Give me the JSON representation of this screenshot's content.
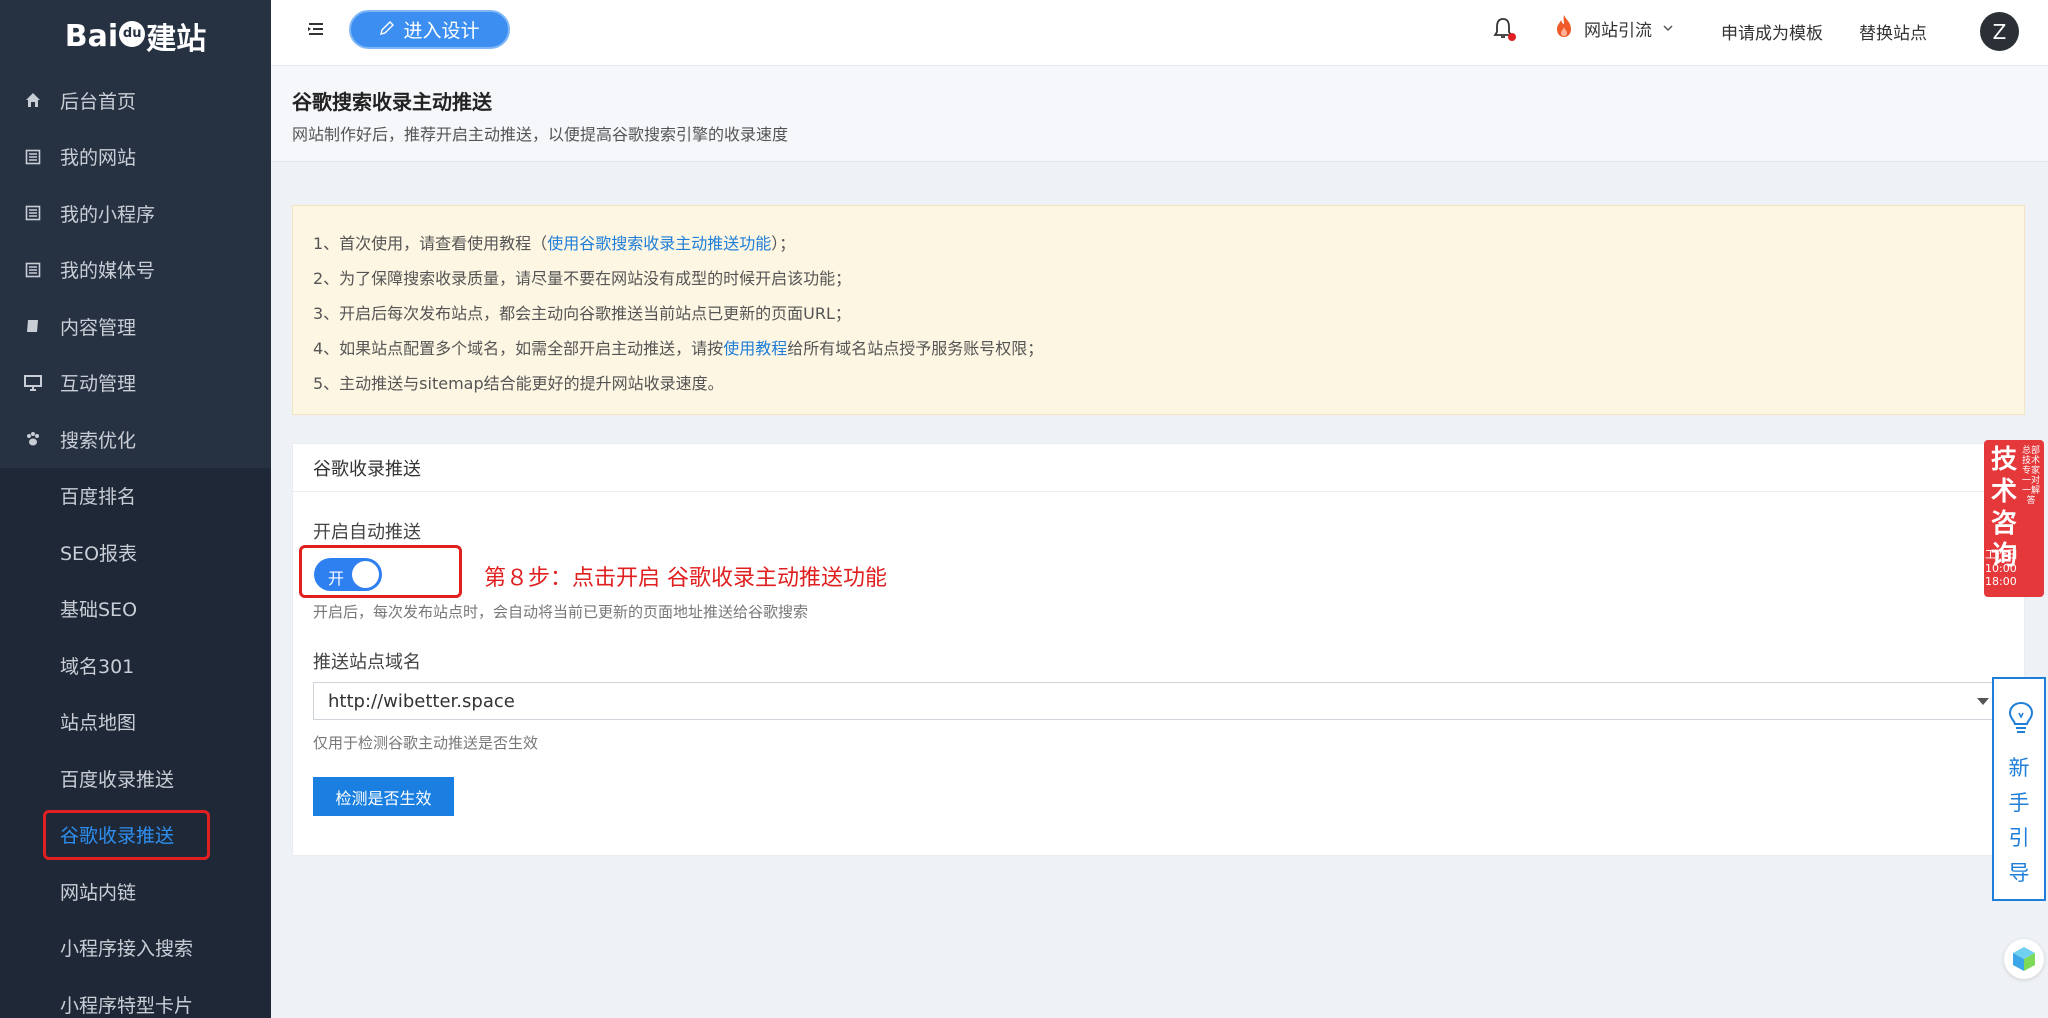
{
  "logo": {
    "text_before": "Bai",
    "paw_text": "du",
    "text_after": "建站"
  },
  "sidebar": {
    "items": [
      {
        "label": "后台首页",
        "icon": "home-icon"
      },
      {
        "label": "我的网站",
        "icon": "document-icon"
      },
      {
        "label": "我的小程序",
        "icon": "document-icon"
      },
      {
        "label": "我的媒体号",
        "icon": "document-icon"
      },
      {
        "label": "内容管理",
        "icon": "book-icon"
      },
      {
        "label": "互动管理",
        "icon": "monitor-icon"
      },
      {
        "label": "搜索优化",
        "icon": "paw-icon"
      }
    ],
    "sub_items": [
      {
        "label": "百度排名"
      },
      {
        "label": "SEO报表"
      },
      {
        "label": "基础SEO"
      },
      {
        "label": "域名301"
      },
      {
        "label": "站点地图"
      },
      {
        "label": "百度收录推送"
      },
      {
        "label": "谷歌收录推送",
        "active": true
      },
      {
        "label": "网站内链"
      },
      {
        "label": "小程序接入搜索"
      },
      {
        "label": "小程序特型卡片"
      }
    ]
  },
  "topbar": {
    "design_button": "进入设计",
    "traffic_label": "网站引流",
    "apply_template": "申请成为模板",
    "switch_site": "替换站点",
    "avatar_letter": "Z"
  },
  "page": {
    "title": "谷歌搜索收录主动推送",
    "subtitle": "网站制作好后，推荐开启主动推送，以便提高谷歌搜索引擎的收录速度"
  },
  "notice": {
    "line1_prefix": "1、首次使用，请查看使用教程（",
    "line1_link": "使用谷歌搜索收录主动推送功能",
    "line1_suffix": "）；",
    "line2": "2、为了保障搜索收录质量，请尽量不要在网站没有成型的时候开启该功能；",
    "line3": "3、开启后每次发布站点，都会主动向谷歌推送当前站点已更新的页面URL；",
    "line4_prefix": "4、如果站点配置多个域名，如需全部开启主动推送，请按",
    "line4_link": "使用教程",
    "line4_suffix": "给所有域名站点授予服务账号权限；",
    "line5": "5、主动推送与sitemap结合能更好的提升网站收录速度。"
  },
  "card": {
    "header": "谷歌收录推送",
    "auto_push_label": "开启自动推送",
    "toggle_text": "开",
    "toggle_on": true,
    "step_note": "第８步：点击开启 谷歌收录主动推送功能",
    "auto_push_hint": "开启后，每次发布站点时，会自动将当前已更新的页面地址推送给谷歌搜索",
    "domain_label": "推送站点域名",
    "domain_value": "http://wibetter.space",
    "domain_hint": "仅用于检测谷歌主动推送是否生效",
    "check_button": "检测是否生效"
  },
  "widgets": {
    "consult_big": "技术咨询",
    "consult_small": "总部技术专家一对一解答",
    "consult_hours_label": "工作日",
    "consult_hours": "10:00 18:00",
    "guide_text": "新手引导"
  },
  "colors": {
    "accent": "#2e7ff0",
    "sidebar": "#263142",
    "highlight_red": "#e02020",
    "notice_bg": "#fdf6e3"
  }
}
